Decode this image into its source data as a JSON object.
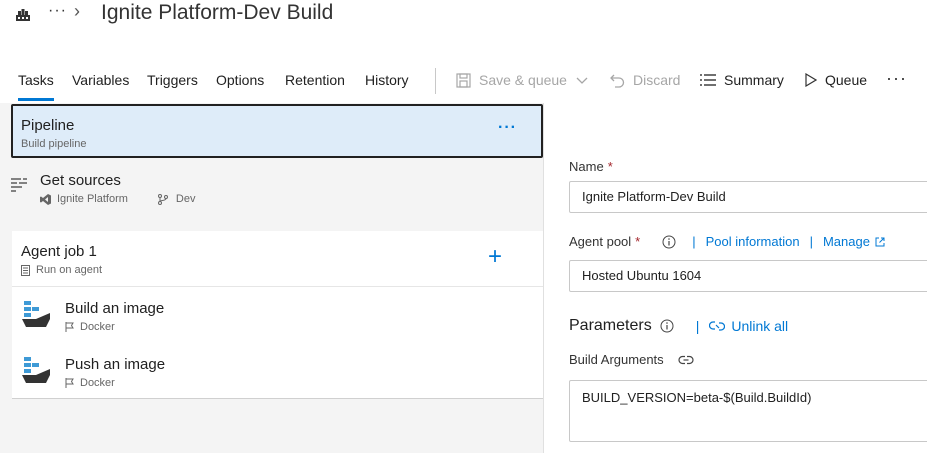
{
  "header": {
    "more": "···",
    "chevron": "›",
    "title": "Ignite Platform-Dev Build"
  },
  "tabs": [
    {
      "label": "Tasks",
      "active": true
    },
    {
      "label": "Variables"
    },
    {
      "label": "Triggers"
    },
    {
      "label": "Options"
    },
    {
      "label": "Retention"
    },
    {
      "label": "History"
    }
  ],
  "commands": {
    "save_queue": "Save & queue",
    "discard": "Discard",
    "summary": "Summary",
    "queue": "Queue",
    "overflow": "···"
  },
  "pipeline": {
    "title": "Pipeline",
    "subtitle": "Build pipeline",
    "menu": "···"
  },
  "get_sources": {
    "title": "Get sources",
    "repo": "Ignite Platform",
    "branch": "Dev"
  },
  "agent_job": {
    "title": "Agent job 1",
    "subtitle": "Run on agent",
    "add": "+",
    "tasks": [
      {
        "title": "Build an image",
        "subtitle": "Docker"
      },
      {
        "title": "Push an image",
        "subtitle": "Docker"
      }
    ]
  },
  "details": {
    "name_label": "Name",
    "required_mark": "*",
    "name_value": "Ignite Platform-Dev Build",
    "agent_pool_label": "Agent pool",
    "pool_information": "Pool information",
    "manage": "Manage",
    "agent_pool_value": "Hosted Ubuntu 1604",
    "parameters_title": "Parameters",
    "unlink_all": "Unlink all",
    "build_arguments_label": "Build Arguments",
    "build_arguments_value": "BUILD_VERSION=beta-$(Build.BuildId)",
    "separator": "|"
  },
  "colors": {
    "accent": "#0078d4",
    "selected_bg": "#deecf9",
    "docker_blue": "#3e9ad6",
    "docker_hull": "#333333"
  }
}
